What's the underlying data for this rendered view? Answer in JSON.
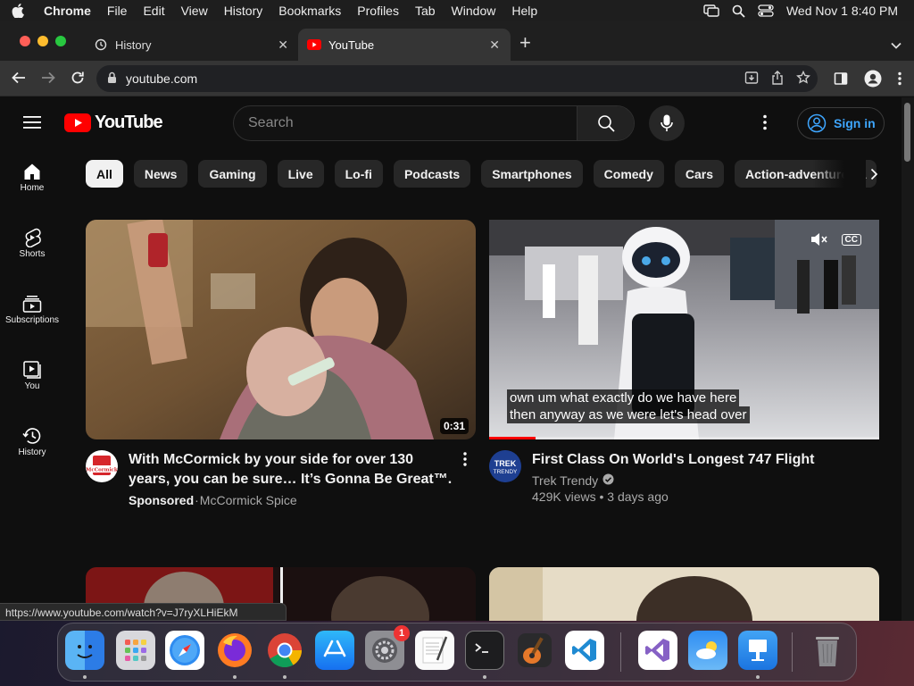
{
  "menubar": {
    "app": "Chrome",
    "items": [
      "File",
      "Edit",
      "View",
      "History",
      "Bookmarks",
      "Profiles",
      "Tab",
      "Window",
      "Help"
    ],
    "clock": "Wed Nov 1  8:40 PM"
  },
  "tabs": [
    {
      "label": "History",
      "icon": "history-icon"
    },
    {
      "label": "YouTube",
      "icon": "youtube-icon"
    }
  ],
  "address": {
    "url": "youtube.com"
  },
  "youtube": {
    "logo": "YouTube",
    "search_placeholder": "Search",
    "sign_in": "Sign in",
    "sidebar": [
      {
        "label": "Home",
        "icon": "home-icon"
      },
      {
        "label": "Shorts",
        "icon": "shorts-icon"
      },
      {
        "label": "Subscriptions",
        "icon": "subscriptions-icon"
      },
      {
        "label": "You",
        "icon": "you-icon"
      },
      {
        "label": "History",
        "icon": "history-icon"
      }
    ],
    "chips": [
      "All",
      "News",
      "Gaming",
      "Live",
      "Lo-fi",
      "Podcasts",
      "Smartphones",
      "Comedy",
      "Cars",
      "Action-adventure ga"
    ],
    "videos": [
      {
        "title": "With McCormick by your side for over 130 years, you can be sure… It’s Gonna Be Great™.",
        "sponsored": "Sponsored",
        "separator": " · ",
        "channel": "McCormick Spice",
        "duration": "0:31",
        "avatar_text": "McCormick"
      },
      {
        "title": "First Class On World's Longest 747 Flight",
        "channel": "Trek Trendy",
        "views": "429K views",
        "age": "3 days ago",
        "views_sep": " • ",
        "avatar_text": "TREK TRENDY",
        "caption_line1": "own um what exactly do we have here",
        "caption_line2": "then anyway as we were let's head over",
        "cc": "CC",
        "progress": 0.12
      }
    ]
  },
  "status_url": "https://www.youtube.com/watch?v=J7ryXLHiEkM",
  "dock": {
    "apps": [
      "finder",
      "launchpad",
      "safari",
      "firefox",
      "chrome",
      "app-store",
      "system-settings",
      "textedit",
      "terminal",
      "garageband",
      "vscode",
      "visual-studio",
      "weather",
      "keynote",
      "trash"
    ],
    "settings_badge": "1"
  },
  "colors": {
    "accent": "#3ea6ff",
    "youtube_red": "#ff0000",
    "background": "#0f0f0f"
  }
}
